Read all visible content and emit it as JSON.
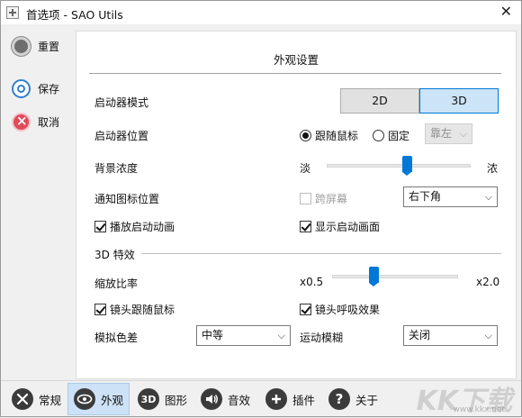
{
  "window": {
    "title": "首选项 - SAO Utils",
    "close_label": "✕"
  },
  "sidebar": {
    "reset_label": "重置",
    "save_label": "保存",
    "cancel_label": "取消"
  },
  "panel": {
    "title": "外观设置",
    "launcher_mode": {
      "label": "启动器模式",
      "options": [
        "2D",
        "3D"
      ],
      "selected": "3D"
    },
    "launcher_position": {
      "label": "启动器位置",
      "follow_mouse_label": "跟随鼠标",
      "fixed_label": "固定",
      "selected": "跟随鼠标",
      "dock_value": "靠左"
    },
    "background_density": {
      "label": "背景浓度",
      "min_label": "淡",
      "max_label": "浓",
      "level_fraction": 0.56
    },
    "notify_icon_position": {
      "label": "通知图标位置",
      "cross_screen_label": "跨屏幕",
      "cross_screen_checked": false,
      "corner_value": "右下角"
    },
    "play_launch_animation": {
      "label": "播放启动动画",
      "checked": true
    },
    "show_splash": {
      "label": "显示启动画面",
      "checked": true
    },
    "effects_3d": {
      "heading": "3D 特效",
      "scale": {
        "label": "缩放比率",
        "min_label": "x0.5",
        "max_label": "x2.0",
        "level_fraction": 0.33
      },
      "lens_follow_mouse": {
        "label": "镜头跟随鼠标",
        "checked": true
      },
      "lens_breathing": {
        "label": "镜头呼吸效果",
        "checked": true
      },
      "chromatic_aberration": {
        "label": "模拟色差",
        "value": "中等"
      },
      "motion_blur": {
        "label": "运动模糊",
        "value": "关闭"
      }
    }
  },
  "bottom_tabs": [
    {
      "label": "常规",
      "icon": "tools-icon"
    },
    {
      "label": "外观",
      "icon": "eye-icon",
      "active": true
    },
    {
      "label": "图形",
      "icon": "3d-icon",
      "icon_text": "3D"
    },
    {
      "label": "音效",
      "icon": "speaker-icon"
    },
    {
      "label": "插件",
      "icon": "plus-icon"
    },
    {
      "label": "关于",
      "icon": "question-icon"
    }
  ],
  "watermark": {
    "text": "KK下载",
    "url": "www.kkx.net"
  },
  "colors": {
    "accent": "#0078d7",
    "active_tab": "#cde2f6",
    "cancel_red": "#e04a5a"
  }
}
